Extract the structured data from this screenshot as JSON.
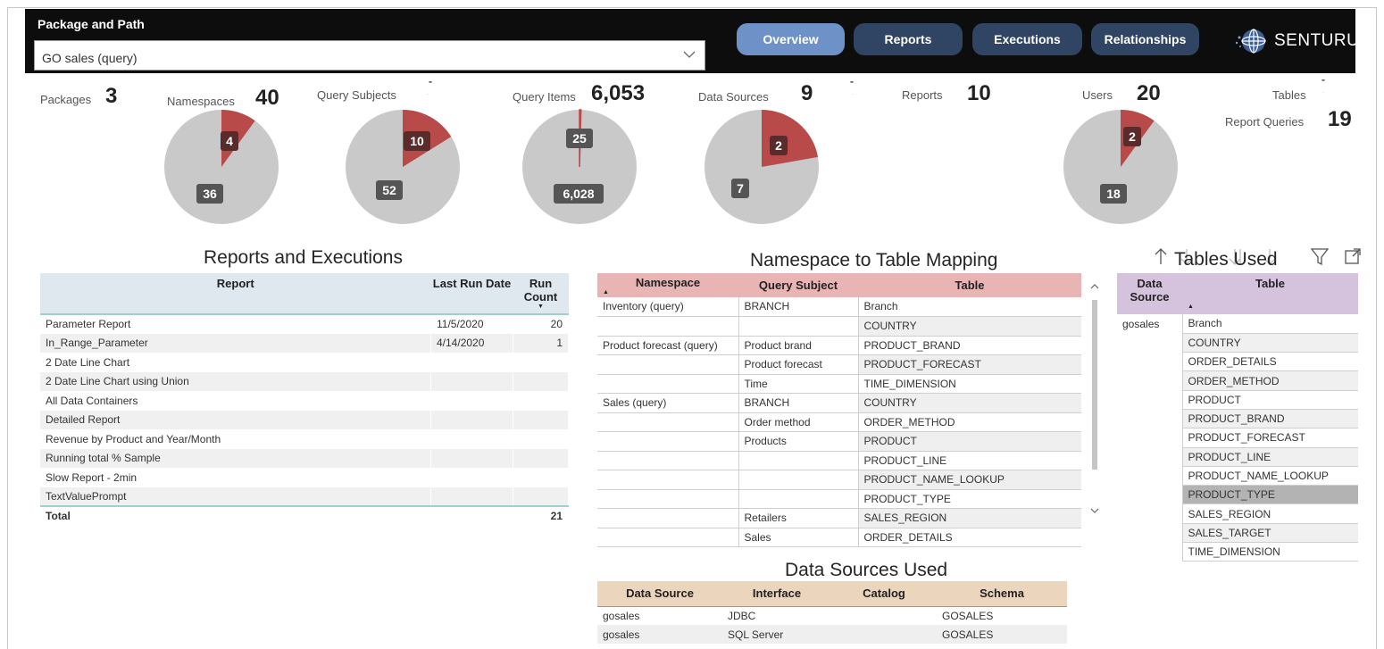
{
  "header": {
    "title": "Package and Path",
    "package_select": {
      "value": "GO sales (query)"
    },
    "nav": [
      {
        "label": "Overview",
        "active": true
      },
      {
        "label": "Reports",
        "active": false
      },
      {
        "label": "Executions",
        "active": false
      },
      {
        "label": "Relationships",
        "active": false
      }
    ],
    "logo_text": "SENTURUS"
  },
  "colors": {
    "accent_active": "#6e92c7",
    "nav": "#2f4563",
    "pie_highlight": "#b84a4a",
    "pie_base": "#c9c9c9"
  },
  "kpis": {
    "packages": {
      "label": "Packages",
      "value": "3"
    },
    "namespaces": {
      "label": "Namespaces",
      "value": "40"
    },
    "query_subjects": {
      "label": "Query Subjects"
    },
    "query_items": {
      "label": "Query Items",
      "value": "6,053"
    },
    "data_sources": {
      "label": "Data Sources",
      "value": "9"
    },
    "reports": {
      "label": "Reports",
      "value": "10"
    },
    "users": {
      "label": "Users",
      "value": "20"
    },
    "tables": {
      "label": "Tables"
    },
    "report_queries": {
      "label": "Report Queries",
      "value": "19"
    }
  },
  "pies": [
    {
      "name": "namespaces",
      "highlight": 4,
      "rest": 36
    },
    {
      "name": "query-subjects",
      "highlight": 10,
      "rest": 52
    },
    {
      "name": "query-items",
      "highlight": 25,
      "rest": 6028
    },
    {
      "name": "data-sources",
      "highlight": 2,
      "rest": 7
    },
    {
      "name": "users",
      "highlight": 2,
      "rest": 18
    }
  ],
  "pie_labels": {
    "namespaces_hi": "4",
    "namespaces_rest": "36",
    "query_subjects_hi": "10",
    "query_subjects_rest": "52",
    "query_items_hi": "25",
    "query_items_rest": "6,028",
    "data_sources_hi": "2",
    "data_sources_rest": "7",
    "users_hi": "2",
    "users_rest": "18"
  },
  "reports_table": {
    "title": "Reports and Executions",
    "columns": [
      "Report",
      "Last Run Date",
      "Run Count"
    ],
    "rows": [
      {
        "report": "Parameter Report",
        "date": "11/5/2020",
        "count": "20"
      },
      {
        "report": "In_Range_Parameter",
        "date": "4/14/2020",
        "count": "1"
      },
      {
        "report": "2 Date Line Chart",
        "date": "",
        "count": ""
      },
      {
        "report": "2 Date Line Chart using Union",
        "date": "",
        "count": ""
      },
      {
        "report": "All Data Containers",
        "date": "",
        "count": ""
      },
      {
        "report": "Detailed Report",
        "date": "",
        "count": ""
      },
      {
        "report": "Revenue by Product and Year/Month",
        "date": "",
        "count": ""
      },
      {
        "report": "Running total % Sample",
        "date": "",
        "count": ""
      },
      {
        "report": "Slow Report - 2min",
        "date": "",
        "count": ""
      },
      {
        "report": "TextValuePrompt",
        "date": "",
        "count": ""
      }
    ],
    "total": {
      "label": "Total",
      "count": "21"
    }
  },
  "ns_table": {
    "title": "Namespace to Table Mapping",
    "columns": [
      "Namespace",
      "Query Subject",
      "Table"
    ],
    "rows": [
      {
        "ns": "Inventory (query)",
        "qs": "BRANCH",
        "table": "Branch"
      },
      {
        "ns": "",
        "qs": "",
        "table": "COUNTRY"
      },
      {
        "ns": "Product forecast (query)",
        "qs": "Product brand",
        "table": "PRODUCT_BRAND"
      },
      {
        "ns": "",
        "qs": "Product forecast",
        "table": "PRODUCT_FORECAST"
      },
      {
        "ns": "",
        "qs": "Time",
        "table": "TIME_DIMENSION"
      },
      {
        "ns": "Sales (query)",
        "qs": "BRANCH",
        "table": "COUNTRY"
      },
      {
        "ns": "",
        "qs": "Order method",
        "table": "ORDER_METHOD"
      },
      {
        "ns": "",
        "qs": "Products",
        "table": "PRODUCT"
      },
      {
        "ns": "",
        "qs": "",
        "table": "PRODUCT_LINE"
      },
      {
        "ns": "",
        "qs": "",
        "table": "PRODUCT_NAME_LOOKUP"
      },
      {
        "ns": "",
        "qs": "",
        "table": "PRODUCT_TYPE"
      },
      {
        "ns": "",
        "qs": "Retailers",
        "table": "SALES_REGION"
      },
      {
        "ns": "",
        "qs": "Sales",
        "table": "ORDER_DETAILS"
      }
    ]
  },
  "tables_used": {
    "title": "Tables Used",
    "columns": [
      "Data Source",
      "Table"
    ],
    "source": "gosales",
    "rows": [
      "Branch",
      "COUNTRY",
      "ORDER_DETAILS",
      "ORDER_METHOD",
      "PRODUCT",
      "PRODUCT_BRAND",
      "PRODUCT_FORECAST",
      "PRODUCT_LINE",
      "PRODUCT_NAME_LOOKUP",
      "PRODUCT_TYPE",
      "SALES_REGION",
      "SALES_TARGET",
      "TIME_DIMENSION"
    ],
    "selected": "PRODUCT_TYPE"
  },
  "data_sources_table": {
    "title": "Data Sources Used",
    "columns": [
      "Data Source",
      "Interface",
      "Catalog",
      "Schema"
    ],
    "rows": [
      {
        "ds": "gosales",
        "iface": "JDBC",
        "catalog": "",
        "schema": "GOSALES"
      },
      {
        "ds": "gosales",
        "iface": "SQL Server",
        "catalog": "",
        "schema": "GOSALES"
      }
    ]
  }
}
